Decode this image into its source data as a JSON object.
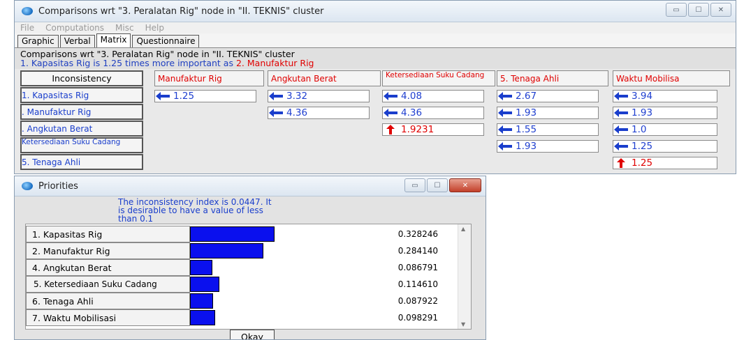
{
  "main_window": {
    "title": "Comparisons wrt \"3. Peralatan Rig\" node in \"II. TEKNIS\" cluster",
    "menu": [
      "File",
      "Computations",
      "Misc",
      "Help"
    ],
    "tabs": [
      "Graphic",
      "Verbal",
      "Matrix",
      "Questionnaire"
    ],
    "active_tab": "Matrix",
    "header_line1": "Comparisons wrt \"3. Peralatan Rig\" node in \"II. TEKNIS\" cluster",
    "header_line2": {
      "part1": "1. Kapasitas Rig",
      "part2": " is 1.25 times more important as ",
      "part3": "2. Manufaktur Rig"
    },
    "inconsistency_button": "Inconsistency",
    "columns": [
      "Manufaktur Rig",
      "Angkutan Berat",
      "Ketersediaan Suku Cadang",
      "5. Tenaga Ahli",
      "Waktu Mobilisa"
    ],
    "rows": [
      "1. Kapasitas Rig",
      ". Manufaktur Rig",
      ". Angkutan Berat",
      "Ketersediaan Suku Cadang",
      "5. Tenaga Ahli"
    ],
    "cells": [
      {
        "row": 0,
        "col": 0,
        "arrow": "left",
        "value": "1.25"
      },
      {
        "row": 0,
        "col": 1,
        "arrow": "left",
        "value": "3.32"
      },
      {
        "row": 0,
        "col": 2,
        "arrow": "left",
        "value": "4.08"
      },
      {
        "row": 0,
        "col": 3,
        "arrow": "left",
        "value": "2.67"
      },
      {
        "row": 0,
        "col": 4,
        "arrow": "left",
        "value": "3.94"
      },
      {
        "row": 1,
        "col": 1,
        "arrow": "left",
        "value": "4.36"
      },
      {
        "row": 1,
        "col": 2,
        "arrow": "left",
        "value": "4.36"
      },
      {
        "row": 1,
        "col": 3,
        "arrow": "left",
        "value": "1.93"
      },
      {
        "row": 1,
        "col": 4,
        "arrow": "left",
        "value": "1.93"
      },
      {
        "row": 2,
        "col": 2,
        "arrow": "up",
        "value": "1.9231"
      },
      {
        "row": 2,
        "col": 3,
        "arrow": "left",
        "value": "1.55"
      },
      {
        "row": 2,
        "col": 4,
        "arrow": "left",
        "value": "1.0"
      },
      {
        "row": 3,
        "col": 3,
        "arrow": "left",
        "value": "1.93"
      },
      {
        "row": 3,
        "col": 4,
        "arrow": "left",
        "value": "1.25"
      },
      {
        "row": 4,
        "col": 4,
        "arrow": "up",
        "value": "1.25"
      }
    ]
  },
  "priorities_window": {
    "title": "Priorities",
    "message": "The inconsistency index is 0.0447.  It is desirable to have a value of less than 0.1",
    "items": [
      {
        "label": "1. Kapasitas Rig",
        "value": "0.328246",
        "weight": 0.328246
      },
      {
        "label": "2. Manufaktur Rig",
        "value": "0.284140",
        "weight": 0.28414
      },
      {
        "label": "4. Angkutan Berat",
        "value": "0.086791",
        "weight": 0.086791
      },
      {
        "label": "5. Ketersediaan Suku Cadang",
        "value": "0.114610",
        "weight": 0.11461
      },
      {
        "label": "6. Tenaga Ahli",
        "value": "0.087922",
        "weight": 0.087922
      },
      {
        "label": "7. Waktu Mobilisasi",
        "value": "0.098291",
        "weight": 0.098291
      }
    ],
    "okay_button": "Okay"
  },
  "colors": {
    "blue_text": "#1a3ecc",
    "red_text": "#e00000",
    "bar": "#0a10ee"
  }
}
